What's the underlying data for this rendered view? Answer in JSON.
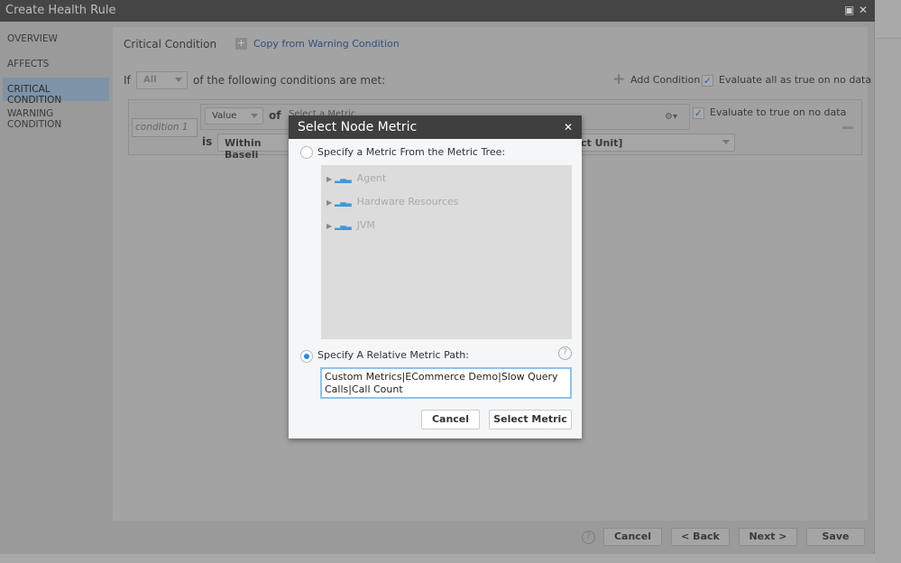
{
  "window": {
    "title": "Create Health Rule",
    "maximize_icon": "maximize-icon",
    "close_icon": "close-icon"
  },
  "sidebar": {
    "items": [
      {
        "label": "OVERVIEW"
      },
      {
        "label": "AFFECTS"
      },
      {
        "label": "CRITICAL CONDITION",
        "active": true
      },
      {
        "label": "WARNING CONDITION"
      }
    ]
  },
  "main": {
    "heading": "Critical Condition",
    "copy_link": "Copy from Warning Condition",
    "if_label": "If",
    "match_select": "All",
    "match_suffix": "of the following conditions are met:",
    "add_condition": "Add Condition",
    "evaluate_all": "Evaluate all as true on no data",
    "evaluate_all_checked": true,
    "condition": {
      "name_placeholder": "condition 1",
      "value_select": "Value",
      "of_label": "of",
      "metric_placeholder": "Select a Metric",
      "is_label": "is",
      "operator": "Within Baseli",
      "unit_fragment": "ct Unit]",
      "evaluate_true": "Evaluate to true on no data",
      "evaluate_true_checked": true
    }
  },
  "footer": {
    "cancel": "Cancel",
    "back": "< Back",
    "next": "Next >",
    "save": "Save"
  },
  "modal": {
    "title": "Select Node Metric",
    "option_tree": "Specify a Metric From the Metric Tree:",
    "tree": [
      {
        "label": "Agent"
      },
      {
        "label": "Hardware Resources"
      },
      {
        "label": "JVM"
      }
    ],
    "option_path": "Specify A Relative Metric Path:",
    "selected_option": "path",
    "path_value": "Custom Metrics|ECommerce Demo|Slow Query Calls|Call Count",
    "cancel": "Cancel",
    "select": "Select Metric"
  },
  "colors": {
    "accent": "#1a8cff",
    "link": "#2f4f80",
    "titlebar": "#454545"
  }
}
